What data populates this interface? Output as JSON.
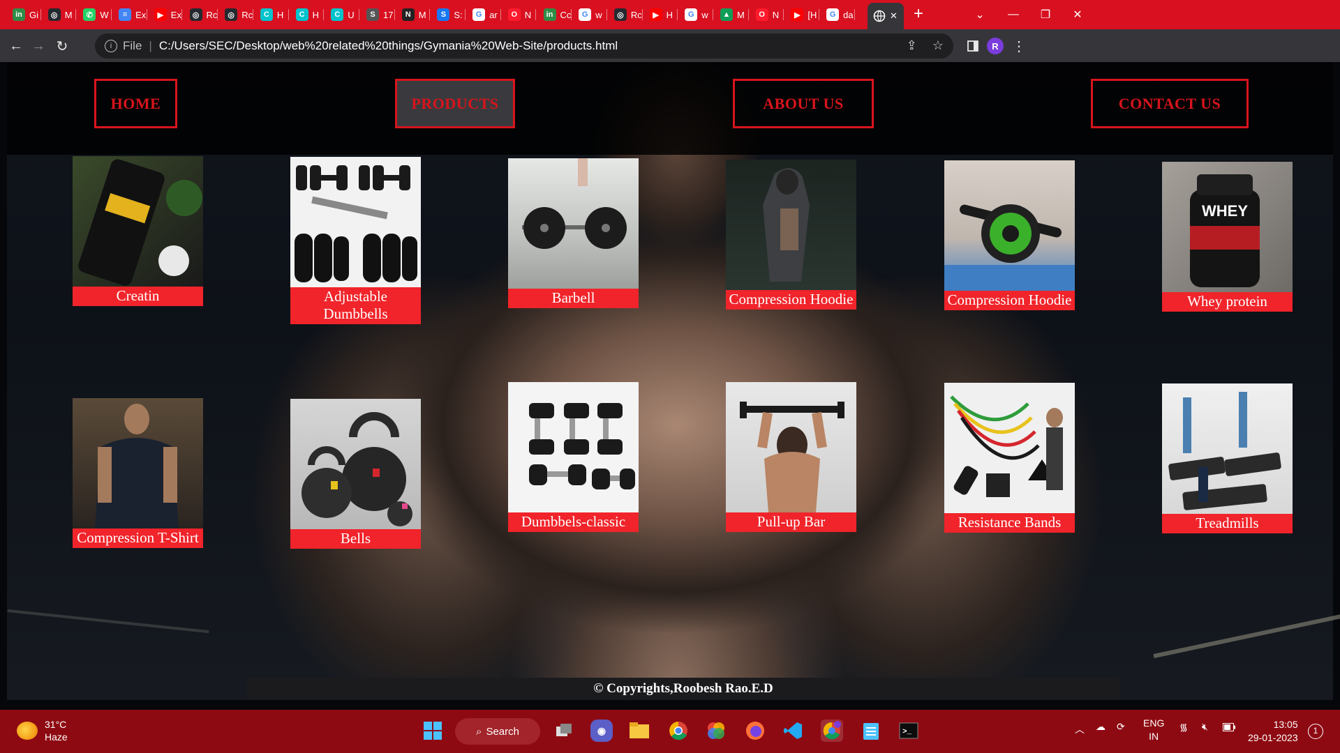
{
  "browser": {
    "tabs": [
      {
        "label": "Gi",
        "icon": "gfg-icon",
        "color": "#2f8d46",
        "glyph": "in"
      },
      {
        "label": "M",
        "icon": "github-icon",
        "color": "#24292e",
        "glyph": "◎"
      },
      {
        "label": "W",
        "icon": "whatsapp-icon",
        "color": "#25d366",
        "glyph": "✆"
      },
      {
        "label": "Ex",
        "icon": "docs-icon",
        "color": "#4285f4",
        "glyph": "≡"
      },
      {
        "label": "Ex",
        "icon": "youtube-icon",
        "color": "#ff0000",
        "glyph": "▶"
      },
      {
        "label": "Rc",
        "icon": "github-icon",
        "color": "#24292e",
        "glyph": "◎"
      },
      {
        "label": "Rc",
        "icon": "github-icon",
        "color": "#24292e",
        "glyph": "◎"
      },
      {
        "label": "H",
        "icon": "canva-icon",
        "color": "#00c4cc",
        "glyph": "C"
      },
      {
        "label": "H",
        "icon": "canva-icon",
        "color": "#00c4cc",
        "glyph": "C"
      },
      {
        "label": "U",
        "icon": "canva-icon",
        "color": "#00c4cc",
        "glyph": "C"
      },
      {
        "label": "17",
        "icon": "s-icon",
        "color": "#555555",
        "glyph": "S"
      },
      {
        "label": "M",
        "icon": "n-icon",
        "color": "#222222",
        "glyph": "N"
      },
      {
        "label": "S:",
        "icon": "s-blue-icon",
        "color": "#1877f2",
        "glyph": "S"
      },
      {
        "label": "ar",
        "icon": "google-icon",
        "color": "#ffffff",
        "glyph": "G"
      },
      {
        "label": "N",
        "icon": "opera-icon",
        "color": "#ff1b2d",
        "glyph": "O"
      },
      {
        "label": "Cc",
        "icon": "gfg-icon",
        "color": "#2f8d46",
        "glyph": "in"
      },
      {
        "label": "w",
        "icon": "google-icon",
        "color": "#ffffff",
        "glyph": "G"
      },
      {
        "label": "Rc",
        "icon": "github-icon",
        "color": "#24292e",
        "glyph": "◎"
      },
      {
        "label": "H",
        "icon": "youtube-icon",
        "color": "#ff0000",
        "glyph": "▶"
      },
      {
        "label": "w",
        "icon": "google-icon",
        "color": "#ffffff",
        "glyph": "G"
      },
      {
        "label": "M",
        "icon": "drive-icon",
        "color": "#0f9d58",
        "glyph": "▲"
      },
      {
        "label": "N",
        "icon": "opera-icon",
        "color": "#ff1b2d",
        "glyph": "O"
      },
      {
        "label": "[H",
        "icon": "youtube-icon",
        "color": "#ff0000",
        "glyph": "▶"
      },
      {
        "label": "da",
        "icon": "google-icon",
        "color": "#ffffff",
        "glyph": "G"
      }
    ],
    "active_tab_icon": "globe-icon",
    "active_tab_close": "✕",
    "new_tab": "+",
    "url_scheme": "File",
    "url": "C:/Users/SEC/Desktop/web%20related%20things/Gymania%20Web-Site/products.html",
    "profile_initial": "R"
  },
  "site": {
    "nav": [
      {
        "label": "HOME",
        "active": false
      },
      {
        "label": "PRODUCTS",
        "active": true
      },
      {
        "label": "ABOUT US",
        "active": false
      },
      {
        "label": "CONTACT US",
        "active": false
      }
    ],
    "products": [
      {
        "name": "Creatin",
        "image": "creatine-tub-image"
      },
      {
        "name": "Adjustable Dumbbells",
        "image": "adjustable-dumbbells-image"
      },
      {
        "name": "Barbell",
        "image": "barbell-image"
      },
      {
        "name": "Compression Hoodie",
        "image": "hoodie-image"
      },
      {
        "name": "Compression Hoodie",
        "image": "ab-roller-image"
      },
      {
        "name": "Whey protein",
        "image": "whey-tub-image"
      },
      {
        "name": "Compression T-Shirt",
        "image": "tshirt-model-image"
      },
      {
        "name": "Bells",
        "image": "kettlebells-image"
      },
      {
        "name": "Dumbbels-classic",
        "image": "classic-dumbbells-image"
      },
      {
        "name": "Pull-up Bar",
        "image": "pullup-bar-image"
      },
      {
        "name": "Resistance Bands",
        "image": "resistance-bands-image"
      },
      {
        "name": "Treadmills",
        "image": "treadmills-image"
      }
    ],
    "footer": "© Copyrights,Roobesh Rao.E.D"
  },
  "taskbar": {
    "weather_temp": "31°C",
    "weather_desc": "Haze",
    "search_label": "Search",
    "apps": [
      "windows-start-icon",
      "task-view-icon",
      "teams-chat-icon",
      "file-explorer-icon",
      "chrome-icon",
      "photos-icon",
      "firefox-icon",
      "vscode-icon",
      "chrome-profile-icon",
      "notepad-icon",
      "terminal-icon"
    ],
    "lang_line1": "ENG",
    "lang_line2": "IN",
    "time": "13:05",
    "date": "29-01-2023",
    "notification_count": "1"
  }
}
